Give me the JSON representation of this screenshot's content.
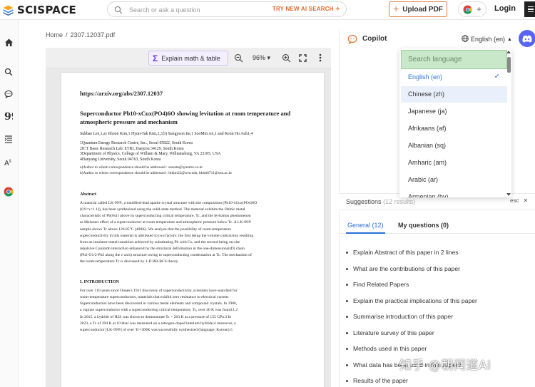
{
  "brand": {
    "name": "SCISPACE"
  },
  "search": {
    "placeholder": "Search or ask a question",
    "badge": "TRY NEW AI SEARCH"
  },
  "header": {
    "upload_label": "Upload PDF",
    "login_label": "Login"
  },
  "breadcrumb": {
    "home": "Home",
    "separator": "/",
    "file": "2307.12037.pdf"
  },
  "pdf_toolbar": {
    "explain_label": "Explain math & table",
    "zoom": "96%"
  },
  "paper": {
    "url": "https://arxiv.org/abs/2307.12037",
    "title_line1": "Superconductor Pb10-xCux(PO4)6O showing levitation at room temperature and",
    "title_line2": "atmospheric pressure and mechanism",
    "authors": "Sukbae Lee,1,a) Jihoon Kim,1 Hyun-Tak Kim,2,3,b) Sungyeon Im,1 SooMin An,1 and Keun Ho Auh1,4",
    "affiliations": [
      "1Quantum Energy Research Centre, Inc., Seoul 05822, South Korea",
      "2ICT Basic Research Lab. ETRI, Daejeon 34129, South Korea",
      "3Department of Physics, College of William & Mary, Williamsburg, VA 23185, USA",
      "4Hanyang University, Seoul 04763, South Korea"
    ],
    "emails": [
      "a)Author to whom correspondence should be addressed : ssaram@qcentre.co.kr",
      "b)Author to whom correspondence should be addressed : htkim22@wm.edu, hkim0711@snu.ac.kr"
    ],
    "abstract_heading": "Abstract",
    "abstract_lines": [
      "A material called LK-99®, a modified-lead apatite crystal structure with the composition (Pb10-xCux(PO4)6O",
      "(0.9<x<1.1)), has been synthesized using the solid-state method. The material exhibits the Ohmic metal",
      "characteristic of Pb(6s1) above its superconducting critical temperature, Tc, and the levitation phenomenon",
      "as Meissner effect of a superconductor at room temperature and atmospheric pressure below Tc. A LK-99®",
      "sample shows Tc above 126.85°C (400K). We analyze that the possibility of room-temperature",
      "superconductivity in this material is attributed to two factors: the first being the volume contraction resulting",
      "from an insulator-metal transition achieved by substituting Pb with Cu, and the second being on-site",
      "repulsive Coulomb interaction enhanced by the structural deformation in the one-dimensional(D) chain",
      "(Pb2-O1/2-Pb2 along the c-axis) structure owing to superconducting condensation at Tc. The mechanism of",
      "the room-temperature Tc is discussed by 1-D BR-BCS theory."
    ],
    "intro_heading": "I. INTRODUCTION",
    "intro_lines": [
      "For over 110 years since Onnes's 1911 discovery of superconductivity, scientists have searched for",
      "room-temperature superconductors, materials that exhibit zero resistance to electrical current.",
      "Superconductors have been discovered in various metal elements and compound crystals. In 1986,",
      "a cuprate superconductor with a superconducting critical temperature, Tc, over 40 K was found.1,2",
      "In 2015, a hydride of H2S was shown to demonstrate Tc = 203 K at a pressure of 155 GPa.3 In",
      "2023, a Tc of 294 K at 10 kbar was measured on a nitrogen-doped lutetium hydride;4 moreover, a",
      "superconductor [LK-99®] of over Tc=300K was successfully synthesized (language: Korean).5"
    ]
  },
  "copilot": {
    "title": "Copilot",
    "language_selected": "English (en)"
  },
  "language_dropdown": {
    "search_placeholder": "Search language",
    "options": [
      "English (en)",
      "Chinese (zh)",
      "Japanese (ja)",
      "Afrikaans (af)",
      "Albanian (sq)",
      "Amharic (am)",
      "Arabic (ar)",
      "Armenian (hy)"
    ]
  },
  "suggestions": {
    "title": "Suggestions",
    "count_text": "(12 results)",
    "esc_label": "esc",
    "tabs": [
      "General (12)",
      "My questions (0)"
    ],
    "items": [
      "Explain Abstract of this paper in 2 lines",
      "What are the contributions of this paper",
      "Find Related Papers",
      "Explain the practical implications of this paper",
      "Summarise introduction of this paper",
      "Literature survey of this paper",
      "Methods used in this paper",
      "What data has been used in this paper?",
      "Results of the paper"
    ]
  },
  "watermark": "知乎 @朝闻道AI",
  "colors": {
    "accent_orange": "#e07b3a",
    "accent_blue": "#2a6fdb",
    "sigma_purple": "#6a3de8",
    "dropdown_search_bg": "#c9e7c9",
    "discord": "#5865f2"
  }
}
